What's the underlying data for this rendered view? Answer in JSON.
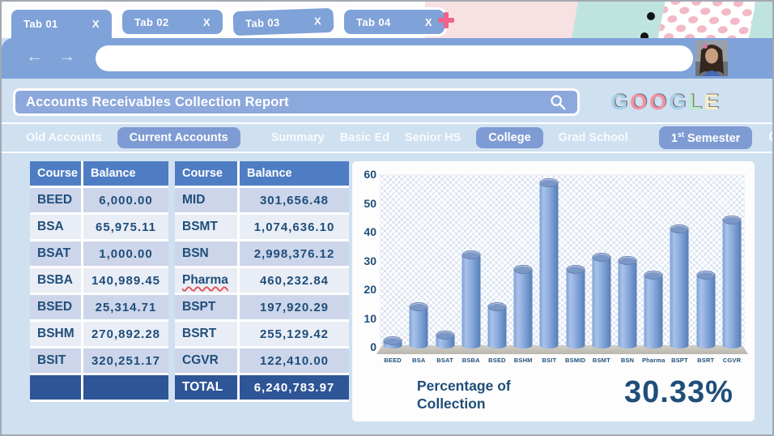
{
  "browser": {
    "tabs": [
      {
        "label": "Tab 01",
        "close": "X",
        "active": true
      },
      {
        "label": "Tab 02",
        "close": "X"
      },
      {
        "label": "Tab 03",
        "close": "X",
        "tilted": true
      },
      {
        "label": "Tab 04",
        "close": "X"
      }
    ],
    "back_glyph": "←",
    "forward_glyph": "→",
    "url_value": "",
    "icons": {
      "new_tab": "plus-icon",
      "tab_close": "x-icon",
      "profile": "avatar-photo"
    }
  },
  "header": {
    "title": "Accounts Receivables Collection Report",
    "search_icon": "magnifier-icon",
    "logo": {
      "letters": [
        {
          "ch": "G",
          "color": "#a6d0e8"
        },
        {
          "ch": "O",
          "color": "#f193a1"
        },
        {
          "ch": "O",
          "color": "#f193a1"
        },
        {
          "ch": "G",
          "color": "#a6d0e8"
        },
        {
          "ch": "L",
          "color": "#b8ecc6"
        },
        {
          "ch": "E",
          "color": "#f7ecc5"
        }
      ]
    }
  },
  "filters": {
    "items": [
      {
        "label": "Old Accounts",
        "active": false
      },
      {
        "label": "Current Accounts",
        "active": true
      },
      {
        "divider": true
      },
      {
        "label": "Summary",
        "active": false
      },
      {
        "label": "Basic Ed",
        "active": false
      },
      {
        "label": "Senior HS",
        "active": false
      },
      {
        "label": "College",
        "active": true
      },
      {
        "label": "Grad School",
        "active": false
      },
      {
        "divider": true,
        "push": true
      },
      {
        "label": "1st Semester",
        "active": true,
        "parts": {
          "num": "1",
          "sup": "st",
          "rest": " Semester"
        }
      }
    ],
    "search_icon": "magnifier-icon"
  },
  "tables": [
    {
      "headers": [
        "Course",
        "Balance"
      ],
      "rows": [
        {
          "course": "BEED",
          "balance": "6,000.00"
        },
        {
          "course": "BSA",
          "balance": "65,975.11"
        },
        {
          "course": "BSAT",
          "balance": "1,000.00"
        },
        {
          "course": "BSBA",
          "balance": "140,989.45"
        },
        {
          "course": "BSED",
          "balance": "25,314.71"
        },
        {
          "course": "BSHM",
          "balance": "270,892.28"
        },
        {
          "course": "BSIT",
          "balance": "320,251.17"
        }
      ],
      "footer": {
        "course": "",
        "balance": ""
      }
    },
    {
      "headers": [
        "Course",
        "Balance"
      ],
      "rows": [
        {
          "course": "MID",
          "balance": "301,656.48"
        },
        {
          "course": "BSMT",
          "balance": "1,074,636.10"
        },
        {
          "course": "BSN",
          "balance": "2,998,376.12"
        },
        {
          "course": "Pharma",
          "balance": "460,232.84",
          "squiggle": true
        },
        {
          "course": "BSPT",
          "balance": "197,920.29"
        },
        {
          "course": "BSRT",
          "balance": "255,129.42"
        },
        {
          "course": "CGVR",
          "balance": "122,410.00"
        }
      ],
      "footer": {
        "course": "TOTAL",
        "balance": "6,240,783.97"
      }
    }
  ],
  "chart_data": {
    "type": "bar",
    "style": "3d-cylinder",
    "title": "",
    "xlabel": "",
    "ylabel": "",
    "categories": [
      "BEED",
      "BSA",
      "BSAT",
      "BSBA",
      "BSED",
      "BSHM",
      "BSIT",
      "BSMID",
      "BSMT",
      "BSN",
      "Pharma",
      "BSPT",
      "BSRT",
      "CGVR"
    ],
    "values": [
      3,
      15,
      5,
      33,
      15,
      28,
      58,
      28,
      32,
      31,
      26,
      42,
      26,
      45
    ],
    "ylim": [
      0,
      60
    ],
    "yticks": [
      0,
      10,
      20,
      30,
      40,
      50,
      60
    ],
    "grid": false,
    "legend": false,
    "background_pattern": "crosshatch"
  },
  "summary": {
    "label": "Percentage of Collection",
    "value": "30.33%"
  },
  "colors": {
    "chrome_blue": "#7fa2d8",
    "content_bg": "#cfe0f1",
    "accent_navy": "#1f4e79",
    "table_header": "#4f7dc3",
    "table_total_row": "#2e5596",
    "bar_fill": "#7da2d8",
    "new_tab_pink": "#f0618b"
  }
}
